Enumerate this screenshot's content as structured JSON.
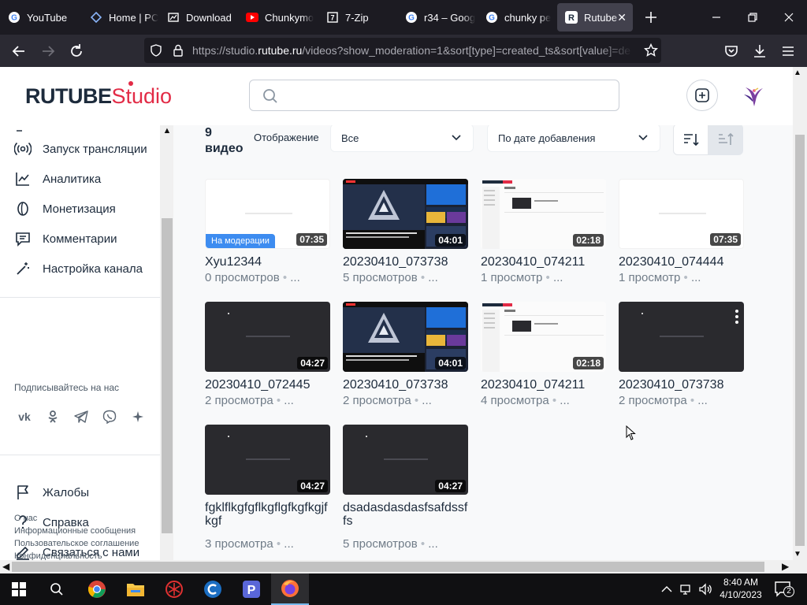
{
  "browser": {
    "tabs": [
      {
        "label": "YouTube",
        "icon": "youtube-icon"
      },
      {
        "label": "Home | PC",
        "icon": "pc-icon"
      },
      {
        "label": "Download",
        "icon": "download-icon"
      },
      {
        "label": "Chunkymo",
        "icon": "youtube-icon"
      },
      {
        "label": "7-Zip",
        "icon": "7zip-icon"
      },
      {
        "label": "r34 – Goog",
        "icon": "google-icon"
      },
      {
        "label": "chunky pe",
        "icon": "google-icon"
      },
      {
        "label": "Rutube",
        "icon": "rutube-icon",
        "active": true
      }
    ],
    "url": {
      "scheme": "https://studio.",
      "domain": "rutube.ru",
      "path": "/videos?show_moderation=1&sort[type]=created_ts&sort[value]=de"
    }
  },
  "header": {
    "logo_main": "RUTUBE",
    "logo_studio": "Studio",
    "search_placeholder": ""
  },
  "sidebar": {
    "items": [
      {
        "label": "Запуск трансляции",
        "icon": "broadcast-icon"
      },
      {
        "label": "Аналитика",
        "icon": "analytics-icon"
      },
      {
        "label": "Монетизация",
        "icon": "coin-icon"
      },
      {
        "label": "Комментарии",
        "icon": "comments-icon"
      },
      {
        "label": "Настройка канала",
        "icon": "magic-wand-icon"
      }
    ],
    "follow_title": "Подписывайтесь на нас",
    "socials": [
      "vk-icon",
      "ok-icon",
      "telegram-icon",
      "viber-icon",
      "more-social-icon"
    ],
    "help_items": [
      {
        "label": "Жалобы",
        "icon": "flag-icon"
      },
      {
        "label": "Справка",
        "icon": "question-icon"
      },
      {
        "label": "Связаться с нами",
        "icon": "edit-icon"
      }
    ],
    "footer_links": [
      "О нас",
      "Информационные сообщения",
      "Пользовательское соглашение",
      "Конфиденциальность"
    ]
  },
  "toolbar": {
    "count_number": "9",
    "count_word": "видео",
    "display_label": "Отображение",
    "display_value": "Все",
    "sort_value": "По дате добавления"
  },
  "videos": [
    {
      "title": "Xyu12344",
      "views": "0 просмотров",
      "duration": "07:35",
      "thumb": "blank",
      "badge": "На модерации"
    },
    {
      "title": "20230410_073738",
      "views": "5 просмотров",
      "duration": "04:01",
      "thumb": "youtube"
    },
    {
      "title": "20230410_074211",
      "views": "1 просмотр",
      "duration": "02:18",
      "thumb": "rutube"
    },
    {
      "title": "20230410_074444",
      "views": "1 просмотр",
      "duration": "07:35",
      "thumb": "blank"
    },
    {
      "title": "20230410_072445",
      "views": "2 просмотра",
      "duration": "04:27",
      "thumb": "dark"
    },
    {
      "title": "20230410_073738",
      "views": "2 просмотра",
      "duration": "04:01",
      "thumb": "youtube"
    },
    {
      "title": "20230410_074211",
      "views": "4 просмотра",
      "duration": "02:18",
      "thumb": "rutube"
    },
    {
      "title": "20230410_073738",
      "views": "2 просмотра",
      "duration": "",
      "thumb": "dark"
    },
    {
      "title": "fgklflkgfgflkgflgfkgfkgjfkgf",
      "views": "3 просмотра",
      "duration": "04:27",
      "thumb": "dark"
    },
    {
      "title": "dsadasdasdasfsafdssffs",
      "views": "5 просмотров",
      "duration": "04:27",
      "thumb": "dark"
    }
  ],
  "meta_more": "...",
  "taskbar": {
    "apps": [
      "windows-start-icon",
      "search-icon",
      "chrome-icon",
      "file-explorer-icon",
      "davinci-icon",
      "ccleaner-icon",
      "p-app-icon",
      "firefox-icon"
    ],
    "time": "8:40 AM",
    "date": "4/10/2023",
    "notification_count": "2"
  },
  "colors": {
    "brand_red": "#e22b46",
    "brand_dark": "#1d2b3c",
    "moderation_blue": "#3d8cf0"
  }
}
